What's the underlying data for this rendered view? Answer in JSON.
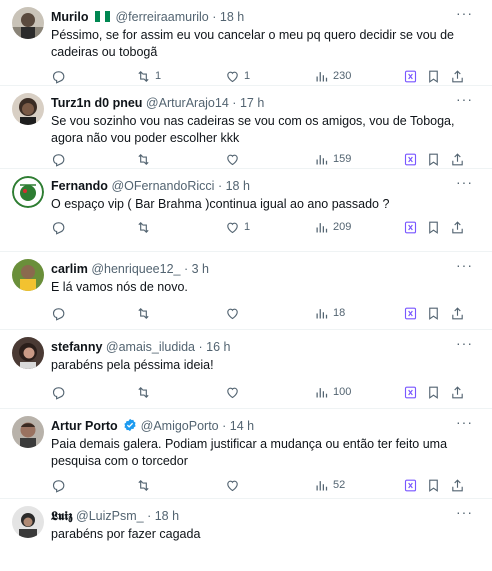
{
  "tweets": [
    {
      "name": "Murilo",
      "flag": "nigeria-flag",
      "handle": "@ferreiraamurilo",
      "time": "18 h",
      "text": "Péssimo, se for assim eu vou cancelar o meu pq quero decidir se vou de cadeiras ou tobogã",
      "retweets": "1",
      "likes": "1",
      "views": "230"
    },
    {
      "name": "Turz1n d0 pneu",
      "handle": "@ArturArajo14",
      "time": "17 h",
      "text": "Se vou sozinho vou nas cadeiras se vou com os amigos, vou de Toboga, agora não vou poder escolher kkk",
      "retweets": "",
      "likes": "",
      "views": "159"
    },
    {
      "name": "Fernando",
      "handle": "@OFernandoRicci",
      "time": "18 h",
      "text": "O espaço vip ( Bar Brahma )continua igual ao ano passado ?",
      "retweets": "",
      "likes": "1",
      "views": "209"
    },
    {
      "name": "carlim",
      "handle": "@henriquee12_",
      "time": "3 h",
      "text": "E lá vamos nós de novo.",
      "retweets": "",
      "likes": "",
      "views": "18"
    },
    {
      "name": "stefanny",
      "handle": "@amais_iludida",
      "time": "16 h",
      "text": "parabéns pela péssima ideia!",
      "retweets": "",
      "likes": "",
      "views": "100"
    },
    {
      "name": "Artur Porto",
      "verified": true,
      "handle": "@AmigoPorto",
      "time": "14 h",
      "text": "Paia demais galera. Podiam justificar a mudança ou então ter feito uma pesquisa com o torcedor",
      "retweets": "",
      "likes": "",
      "views": "52"
    },
    {
      "name": "𝕷𝖚𝖎𝖟",
      "handle": "@LuizPsm_",
      "time": "18 h",
      "text": "parabéns por fazer cagada"
    }
  ],
  "dot": "·",
  "colors": {
    "text": "#0f1419",
    "secondary": "#536471",
    "grok": "#7856ff",
    "verified": "#1d9bf0",
    "divider": "#eff3f4"
  }
}
